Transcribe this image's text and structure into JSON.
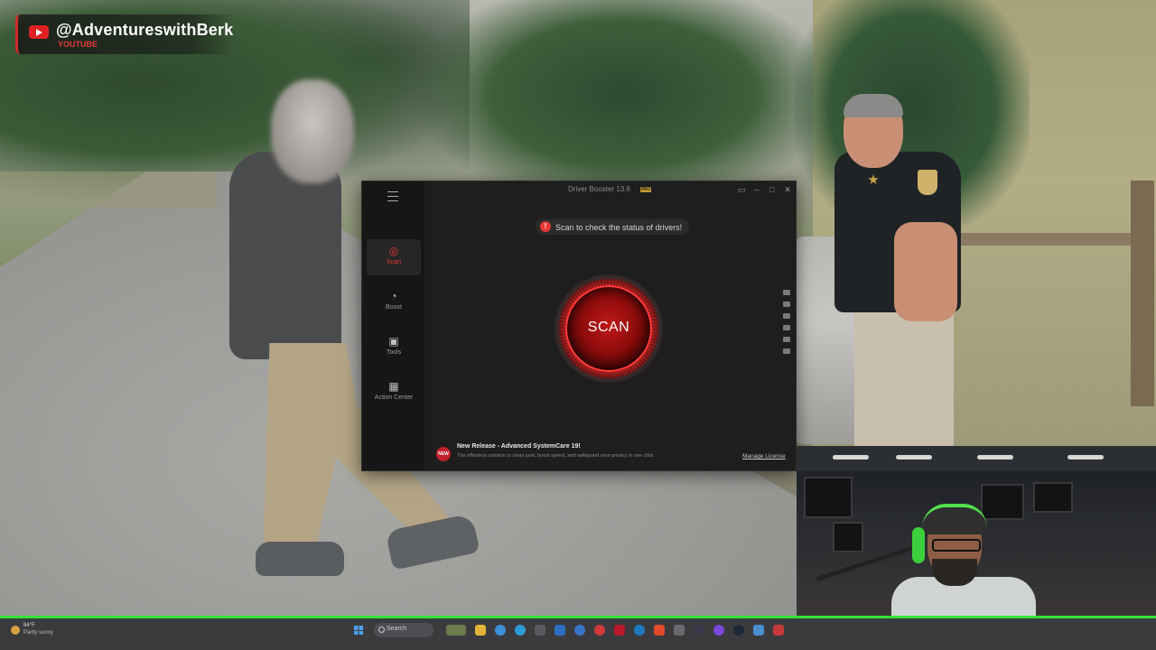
{
  "overlay": {
    "channel_handle": "@AdventureswithBerk",
    "channel_subtitle": "YOUTUBE",
    "accent_color": "#e02020"
  },
  "app": {
    "title": "Driver Booster 13.6",
    "edition_tag": "PRO",
    "nav": [
      {
        "label": "Scan",
        "icon": "scan-icon",
        "active": true
      },
      {
        "label": "Boost",
        "icon": "speedometer-icon",
        "active": false
      },
      {
        "label": "Tools",
        "icon": "toolbox-icon",
        "active": false
      },
      {
        "label": "Action Center",
        "icon": "apps-grid-icon",
        "active": false
      }
    ],
    "status_message": "Scan to check the status of drivers!",
    "scan_button_label": "SCAN",
    "footer": {
      "badge": "NEW",
      "title": "New Release - Advanced SystemCare 19!",
      "description": "The effortless solution to clean junk, boost speed, and safeguard your privacy in one click.",
      "manage_license": "Manage License"
    },
    "accent_color": "#e53935",
    "window_controls": [
      "feedback-icon",
      "minimize-icon",
      "maximize-icon",
      "close-icon"
    ]
  },
  "taskbar": {
    "weather_temp": "84°F",
    "weather_desc": "Partly sunny",
    "search_placeholder": "Search",
    "apps": [
      "file-explorer-icon",
      "chrome-icon",
      "edge-icon",
      "app-icon",
      "app-icon",
      "app-icon",
      "app-icon",
      "app-icon",
      "app-icon",
      "app-icon",
      "app-icon",
      "steam-icon",
      "app-icon",
      "app-icon",
      "app-icon",
      "app-icon"
    ]
  }
}
